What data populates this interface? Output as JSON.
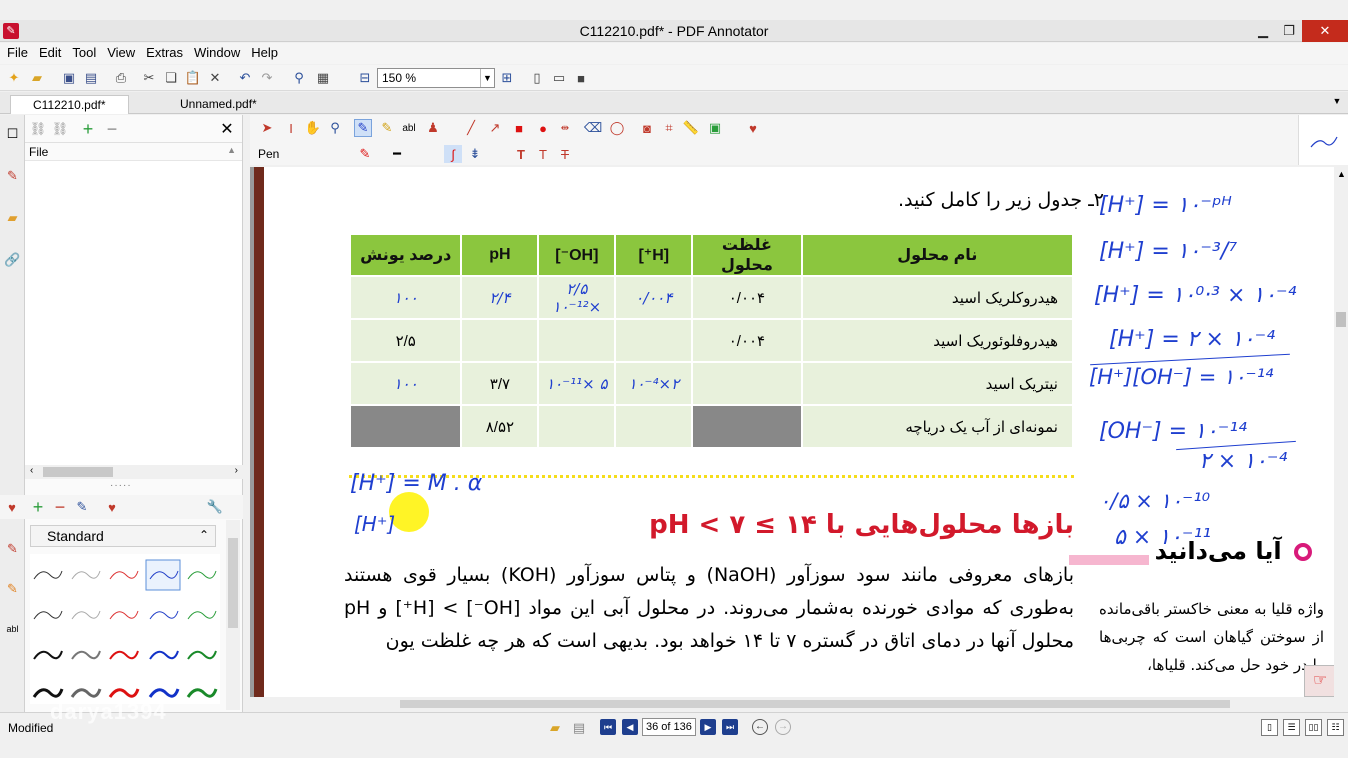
{
  "window": {
    "title": "C112210.pdf* - PDF Annotator"
  },
  "menu": [
    "File",
    "Edit",
    "Tool",
    "View",
    "Extras",
    "Window",
    "Help"
  ],
  "toolbar": {
    "zoom": "150 %"
  },
  "tabs": [
    {
      "label": "C112210.pdf*",
      "active": true
    },
    {
      "label": "Unnamed.pdf*",
      "active": false
    }
  ],
  "left_panel": {
    "file_header": "File"
  },
  "pens_panel": {
    "category": "Standard"
  },
  "annotation_toolbar": {
    "current_tool": "Pen"
  },
  "document": {
    "question_title": "۲ـ جدول زیر را کامل کنید.",
    "table": {
      "headers": [
        "نام محلول",
        "غلظت محلول",
        "[H⁺]",
        "[OH⁻]",
        "pH",
        "درصد یونش"
      ],
      "rows": [
        {
          "name": "هیدروکلریک اسید",
          "concentration": "۰/۰۰۴",
          "h": "۰/۰۰۴",
          "oh": "۲/۵ ×۱۰⁻¹²",
          "ph": "۲/۴",
          "ionization": "۱۰۰"
        },
        {
          "name": "هیدروفلوئوریک اسید",
          "concentration": "۰/۰۰۴",
          "h": "",
          "oh": "",
          "ph": "",
          "ionization": "۲/۵"
        },
        {
          "name": "نیتریک اسید",
          "concentration": "",
          "h": "۲×۱۰⁻⁴",
          "oh": "۵ ×۱۰⁻¹¹",
          "ph": "۳/۷",
          "ionization": "۱۰۰"
        },
        {
          "name": "نمونه‌ای از آب یک دریاچه",
          "concentration": "",
          "h": "",
          "oh": "",
          "ph": "۸/۵۲",
          "ionization": ""
        }
      ]
    },
    "section_heading": "بازها محلول‌هایی با ۱۴ ≥ pH < ۷",
    "paragraph": "بازهای معروفی مانند سود سوزآور (NaOH) و پتاس سوزآور (KOH) بسیار قوی هستند به‌طوری که موادی خورنده به‌شمار می‌روند. در محلول آبی این مواد [OH⁻] > [H⁺] و pH محلول آنها در دمای اتاق در گستره ۷ تا ۱۴ خواهد بود. بدیهی است که هر چه غلظت یون",
    "sidebar_heading": "آیا می‌دانید",
    "sidebar_text": "واژه قلیا به معنی خاکستر باقی‌مانده از سوختن گیاهان است که چربی‌ها را در خود حل می‌کند. قلیاها،",
    "handwriting": {
      "h1": "[H⁺] = ۱۰⁻ᵖᴴ",
      "h2": "[H⁺] = ۱۰⁻³/⁷",
      "h3": "[H⁺] = ۱۰⁰·³ × ۱۰⁻⁴",
      "h4": "[H⁺] = ۲ × ۱۰⁻⁴",
      "h5": "[H⁺][OH⁻] = ۱۰⁻¹⁴",
      "h6": "[OH⁻] = ۱۰⁻¹⁴",
      "h7": "۲ × ۱۰⁻⁴",
      "h8": "۰/۵ × ۱۰⁻¹⁰",
      "h9": "۵ × ۱۰⁻¹¹",
      "h10": "[H⁺] = M . α",
      "h11": "[H⁺]"
    }
  },
  "status": {
    "text": "Modified",
    "watermark": "darya1394",
    "page_indicator": "36 of 136"
  }
}
